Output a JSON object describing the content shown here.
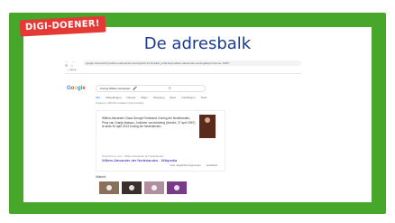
{
  "badge": "DIGI-DOENER!",
  "slide_title": "De adresbalk",
  "browser": {
    "nav_icons": "← → ⟳ ⌂",
    "address": "google.nl/search?q=willem+alexander+koning&rlz=1C1GCEA_enNL&oq=willem+alexander+koning&aqs=chrome..69i57",
    "bookmark": "⬚ Apps"
  },
  "google": {
    "logo": [
      "G",
      "o",
      "o",
      "g",
      "l",
      "e"
    ],
    "query": "Koning Willem-Alexander",
    "mic_icon": "mic-icon",
    "search_icon": "search-icon",
    "tabs": [
      "Alle",
      "Afbeeldingen",
      "Nieuws",
      "Maps",
      "Shopping",
      "Meer",
      "Instellingen",
      "Tools"
    ],
    "stats": "Ongeveer 1.150.000 resultaten (0,42 seconden)"
  },
  "panel": {
    "text": "Willem-Alexander Claus George Ferdinand, Koning der Nederlanden, Prins van Oranje-Nassau, Jonkheer van Amsberg (Utrecht, 27 april 1967) is sinds 30 april 2013 Koning der Nederlanden.",
    "source": "Overzicht op: com · Willem-Alexander der Nederlanden",
    "link": "Willem-Alexander der Nederlanden - Wikipedia",
    "action_1": "Over uitgelichte fragmenten",
    "action_2": "Feedback"
  },
  "videos_label": "Video's"
}
